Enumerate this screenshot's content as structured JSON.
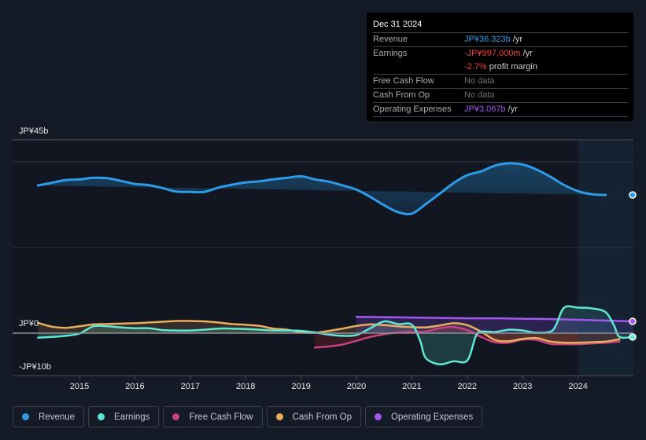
{
  "tooltip": {
    "date": "Dec 31 2024",
    "rows": [
      {
        "label": "Revenue",
        "value": "JP¥36.323b",
        "unit": " /yr",
        "color": "#2d9be8"
      },
      {
        "label": "Earnings",
        "value": "-JP¥997.000m",
        "unit": " /yr",
        "color": "#f04040"
      },
      {
        "label": "",
        "value": "-2.7%",
        "unit": " profit margin",
        "color": "#f04040"
      },
      {
        "label": "Free Cash Flow",
        "value": "No data",
        "unit": "",
        "color": "#6e7278"
      },
      {
        "label": "Cash From Op",
        "value": "No data",
        "unit": "",
        "color": "#6e7278"
      },
      {
        "label": "Operating Expenses",
        "value": "JP¥3.067b",
        "unit": " /yr",
        "color": "#a259f0"
      }
    ]
  },
  "legend": [
    {
      "label": "Revenue",
      "color": "#2d9be8"
    },
    {
      "label": "Earnings",
      "color": "#5ee7d3"
    },
    {
      "label": "Free Cash Flow",
      "color": "#c8427f"
    },
    {
      "label": "Cash From Op",
      "color": "#e9ad5b"
    },
    {
      "label": "Operating Expenses",
      "color": "#a259f0"
    }
  ],
  "chart_data": {
    "type": "area",
    "title": "",
    "xlabel": "",
    "ylabel": "",
    "y_tick_labels": [
      "JP¥45b",
      "JP¥0",
      "-JP¥10b"
    ],
    "y_ticks": [
      45,
      0,
      -10
    ],
    "ylim": [
      -10,
      45
    ],
    "xlim": [
      2014.25,
      2025.0
    ],
    "x_tick_labels": [
      "2015",
      "2016",
      "2017",
      "2018",
      "2019",
      "2020",
      "2021",
      "2022",
      "2023",
      "2024"
    ],
    "x_ticks": [
      2015,
      2016,
      2017,
      2018,
      2019,
      2020,
      2021,
      2022,
      2023,
      2024
    ],
    "forecast_shade_from": 2024.0,
    "grid": true,
    "legend_position": "bottom-left",
    "series": [
      {
        "name": "Revenue",
        "color": "#2d9be8",
        "x": [
          2014.25,
          2014.5,
          2014.75,
          2015.0,
          2015.25,
          2015.5,
          2015.75,
          2016.0,
          2016.25,
          2016.5,
          2016.75,
          2017.0,
          2017.25,
          2017.5,
          2017.75,
          2018.0,
          2018.25,
          2018.5,
          2018.75,
          2019.0,
          2019.25,
          2019.5,
          2019.75,
          2020.0,
          2020.25,
          2020.5,
          2020.75,
          2021.0,
          2021.25,
          2021.5,
          2021.75,
          2022.0,
          2022.25,
          2022.5,
          2022.75,
          2023.0,
          2023.25,
          2023.5,
          2023.75,
          2024.0,
          2024.25,
          2024.5,
          2024.75,
          2025.0
        ],
        "values": [
          38.8,
          39.5,
          40.2,
          40.4,
          40.8,
          40.7,
          40.0,
          39.2,
          38.9,
          38.1,
          37.2,
          37.1,
          37.1,
          38.2,
          39.0,
          39.6,
          39.9,
          40.4,
          40.8,
          41.2,
          40.4,
          39.8,
          38.8,
          37.7,
          35.8,
          33.6,
          31.8,
          31.4,
          33.9,
          36.6,
          39.4,
          41.5,
          42.5,
          44.0,
          44.6,
          44.3,
          43.0,
          41.1,
          38.9,
          37.3,
          36.5,
          36.3,
          36.3
        ]
      },
      {
        "name": "Earnings",
        "color": "#5ee7d3",
        "x": [
          2014.25,
          2014.5,
          2014.75,
          2015.0,
          2015.25,
          2015.5,
          2015.75,
          2016.0,
          2016.25,
          2016.5,
          2016.75,
          2017.0,
          2017.25,
          2017.5,
          2017.75,
          2018.0,
          2018.25,
          2018.5,
          2018.75,
          2019.0,
          2019.25,
          2019.5,
          2019.75,
          2020.0,
          2020.25,
          2020.5,
          2020.75,
          2021.0,
          2021.15,
          2021.25,
          2021.5,
          2021.75,
          2022.0,
          2022.15,
          2022.25,
          2022.5,
          2022.75,
          2023.0,
          2023.25,
          2023.5,
          2023.6,
          2023.75,
          2024.0,
          2024.25,
          2024.5,
          2024.65,
          2024.75,
          2025.0
        ],
        "values": [
          -1.2,
          -1.0,
          -0.7,
          -0.1,
          1.8,
          1.8,
          1.5,
          1.3,
          1.3,
          0.8,
          0.7,
          0.7,
          0.9,
          1.2,
          1.2,
          1.1,
          0.9,
          0.7,
          0.7,
          0.6,
          0.2,
          -0.4,
          -0.7,
          -0.5,
          1.3,
          3.1,
          2.4,
          2.2,
          -2.0,
          -6.5,
          -8.2,
          -7.4,
          -7.2,
          -1.0,
          0.4,
          0.3,
          0.9,
          0.7,
          0.1,
          0.4,
          2.0,
          6.7,
          6.7,
          6.5,
          5.5,
          2.0,
          -1.0,
          -1.0
        ]
      },
      {
        "name": "Free Cash Flow",
        "color": "#c8427f",
        "x": [
          2019.25,
          2019.5,
          2019.75,
          2020.0,
          2020.25,
          2020.5,
          2020.75,
          2021.0,
          2021.25,
          2021.5,
          2021.75,
          2022.0,
          2022.25,
          2022.5,
          2022.75,
          2023.0,
          2023.25,
          2023.5,
          2023.75,
          2024.0,
          2024.25,
          2024.5,
          2024.75
        ],
        "values": [
          -3.8,
          -3.5,
          -3.0,
          -2.0,
          -1.0,
          -0.3,
          0.2,
          0.4,
          0.4,
          1.3,
          1.6,
          0.8,
          -1.0,
          -2.4,
          -2.5,
          -1.7,
          -1.8,
          -2.8,
          -2.9,
          -2.9,
          -2.7,
          -2.5,
          -2.2
        ]
      },
      {
        "name": "Cash From Op",
        "color": "#e9ad5b",
        "x": [
          2014.25,
          2014.5,
          2014.75,
          2015.0,
          2015.25,
          2015.5,
          2015.75,
          2016.0,
          2016.25,
          2016.5,
          2016.75,
          2017.0,
          2017.25,
          2017.5,
          2017.75,
          2018.0,
          2018.25,
          2018.5,
          2018.75,
          2019.0,
          2019.25,
          2019.5,
          2019.75,
          2020.0,
          2020.25,
          2020.5,
          2020.75,
          2021.0,
          2021.25,
          2021.5,
          2021.75,
          2022.0,
          2022.25,
          2022.5,
          2022.75,
          2023.0,
          2023.25,
          2023.5,
          2023.75,
          2024.0,
          2024.25,
          2024.5,
          2024.75
        ],
        "values": [
          2.7,
          1.7,
          1.4,
          1.8,
          2.3,
          2.4,
          2.5,
          2.6,
          2.8,
          3.0,
          3.2,
          3.2,
          3.1,
          2.8,
          2.4,
          2.2,
          1.9,
          1.2,
          0.9,
          0.2,
          0.1,
          0.6,
          1.2,
          1.9,
          2.3,
          2.1,
          1.8,
          1.6,
          1.5,
          2.0,
          2.6,
          2.1,
          0.4,
          -1.8,
          -2.1,
          -1.5,
          -1.3,
          -2.2,
          -2.5,
          -2.5,
          -2.4,
          -2.2,
          -1.6
        ]
      },
      {
        "name": "Operating Expenses",
        "color": "#a259f0",
        "x": [
          2020.0,
          2020.5,
          2021.0,
          2021.5,
          2022.0,
          2022.5,
          2023.0,
          2023.5,
          2024.0,
          2024.5,
          2025.0
        ],
        "values": [
          4.3,
          4.2,
          4.1,
          4.0,
          3.9,
          3.9,
          3.8,
          3.7,
          3.5,
          3.3,
          3.1
        ]
      }
    ]
  }
}
